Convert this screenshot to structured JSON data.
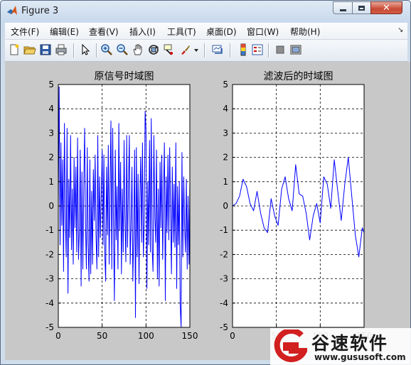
{
  "window": {
    "title": "Figure 3"
  },
  "menu": [
    "文件(F)",
    "编辑(E)",
    "查看(V)",
    "插入(I)",
    "工具(T)",
    "桌面(D)",
    "窗口(W)",
    "帮助(H)"
  ],
  "toolbar_icons": [
    "new-figure-icon",
    "open-folder-icon",
    "save-icon",
    "print-icon",
    "pointer-icon",
    "zoom-in-icon",
    "zoom-out-icon",
    "pan-hand-icon",
    "rotate-3d-icon",
    "data-cursor-icon",
    "brush-icon",
    "link-plot-icon",
    "colorbar-icon",
    "legend-icon",
    "hide-plot-tools-icon",
    "show-plot-tools-icon"
  ],
  "watermark": {
    "name": "谷速软件",
    "url": "www.gususoft.com",
    "color": "#d21f1f"
  },
  "chart_data": [
    {
      "type": "line",
      "title": "原信号时域图",
      "xlabel": "",
      "ylabel": "",
      "xlim": [
        0,
        150
      ],
      "ylim": [
        -5,
        5
      ],
      "xticks": [
        0,
        50,
        100,
        150
      ],
      "yticks": [
        -5,
        -4,
        -3,
        -2,
        -1,
        0,
        1,
        2,
        3,
        4,
        5
      ],
      "grid": true,
      "color": "#0000ff",
      "series": [
        {
          "x": [
            0,
            1,
            2,
            3,
            4,
            5,
            6,
            7,
            8,
            9,
            10,
            11,
            12,
            13,
            14,
            15,
            16,
            17,
            18,
            19,
            20,
            21,
            22,
            23,
            24,
            25,
            26,
            27,
            28,
            29,
            30,
            31,
            32,
            33,
            34,
            35,
            36,
            37,
            38,
            39,
            40,
            41,
            42,
            43,
            44,
            45,
            46,
            47,
            48,
            49,
            50,
            51,
            52,
            53,
            54,
            55,
            56,
            57,
            58,
            59,
            60,
            61,
            62,
            63,
            64,
            65,
            66,
            67,
            68,
            69,
            70,
            71,
            72,
            73,
            74,
            75,
            76,
            77,
            78,
            79,
            80,
            81,
            82,
            83,
            84,
            85,
            86,
            87,
            88,
            89,
            90,
            91,
            92,
            93,
            94,
            95,
            96,
            97,
            98,
            99,
            100,
            101,
            102,
            103,
            104,
            105,
            106,
            107,
            108,
            109,
            110,
            111,
            112,
            113,
            114,
            115,
            116,
            117,
            118,
            119,
            120,
            121,
            122,
            123,
            124,
            125,
            126,
            127,
            128,
            129,
            130,
            131,
            132,
            133,
            134,
            135,
            136,
            137,
            138,
            139,
            140,
            141,
            142,
            143,
            144,
            145,
            146,
            147,
            148,
            149,
            150
          ],
          "y": [
            0,
            4.9,
            -1.6,
            2.6,
            -0.8,
            1.9,
            -2.7,
            3.4,
            -0.4,
            -2.1,
            3.2,
            -3.6,
            1.1,
            -1.3,
            2.9,
            -1.8,
            0.7,
            -2.4,
            2.0,
            -0.9,
            1.6,
            -1.9,
            2.8,
            -2.2,
            -1.1,
            2.3,
            -3.3,
            1.4,
            -2.6,
            0.8,
            3.2,
            -0.7,
            -2.6,
            2.4,
            -1.5,
            -3.1,
            1.9,
            -2.8,
            0.6,
            -2.4,
            1.5,
            -0.6,
            2.1,
            -1.2,
            -2.6,
            2.9,
            -2.1,
            1.2,
            -1.3,
            0.4,
            2.3,
            -1.6,
            2.1,
            -2.0,
            -3.1,
            1.6,
            -1.2,
            2.5,
            -2.4,
            0.9,
            3.5,
            -2.6,
            3.2,
            -1.1,
            -3.9,
            2.3,
            -1.4,
            0.8,
            -2.6,
            3.4,
            -1.0,
            1.8,
            -2.8,
            0.7,
            -1.9,
            2.7,
            -0.5,
            -2.3,
            2.9,
            -1.7,
            0.8,
            2.9,
            -2.4,
            -0.6,
            1.6,
            -3.1,
            -1.1,
            2.3,
            -4.6,
            2.4,
            -2.1,
            1.3,
            -3.2,
            0.4,
            2.0,
            -1.5,
            2.6,
            -2.1,
            -0.6,
            3.9,
            3.1,
            -3.4,
            1.0,
            -1.6,
            2.7,
            -1.9,
            3.6,
            -1.8,
            -2.7,
            2.9,
            -0.4,
            -1.5,
            2.3,
            -3.0,
            0.7,
            -3.3,
            1.8,
            -0.9,
            2.1,
            -2.2,
            0.6,
            2.6,
            -3.9,
            1.2,
            -1.1,
            2.1,
            -1.4,
            2.4,
            -0.3,
            -2.8,
            1.6,
            -1.5,
            0.9,
            -1.7,
            2.6,
            -3.4,
            0.8,
            -1.6,
            1.0,
            -4.1,
            -5.0,
            2.2,
            -2.1,
            1.2,
            -0.8,
            -1.9,
            1.1,
            -2.6,
            0.4,
            -2.4,
            1.0
          ]
        }
      ]
    },
    {
      "type": "line",
      "title": "滤波后的时域图",
      "xlabel": "",
      "ylabel": "",
      "xlim": [
        0,
        150
      ],
      "ylim": [
        -5,
        5
      ],
      "xticks": [
        0,
        50,
        100,
        150
      ],
      "yticks": [
        -5,
        -4,
        -3,
        -2,
        -1,
        0,
        1,
        2,
        3,
        4,
        5
      ],
      "grid": true,
      "color": "#0000ff",
      "series": [
        {
          "x": [
            0,
            4,
            8,
            12,
            16,
            20,
            24,
            28,
            32,
            36,
            40,
            44,
            48,
            52,
            56,
            60,
            64,
            68,
            72,
            76,
            80,
            84,
            88,
            92,
            96,
            100,
            104,
            108,
            112,
            116,
            120,
            124,
            128,
            132,
            136,
            140,
            144,
            148,
            150
          ],
          "y": [
            0,
            0.1,
            0.4,
            1.1,
            0.8,
            0.1,
            -0.2,
            0.6,
            -0.3,
            -0.9,
            -1.1,
            0.3,
            -0.4,
            -0.8,
            0.7,
            1.2,
            0.3,
            -0.2,
            1.7,
            0.5,
            0.4,
            -0.3,
            -1.4,
            -0.4,
            0.1,
            -0.7,
            1.2,
            0.9,
            -0.1,
            1.9,
            0.6,
            -0.6,
            0.9,
            2.0,
            0.4,
            -1.2,
            -2.1,
            -0.9,
            -1.1
          ]
        }
      ]
    }
  ]
}
